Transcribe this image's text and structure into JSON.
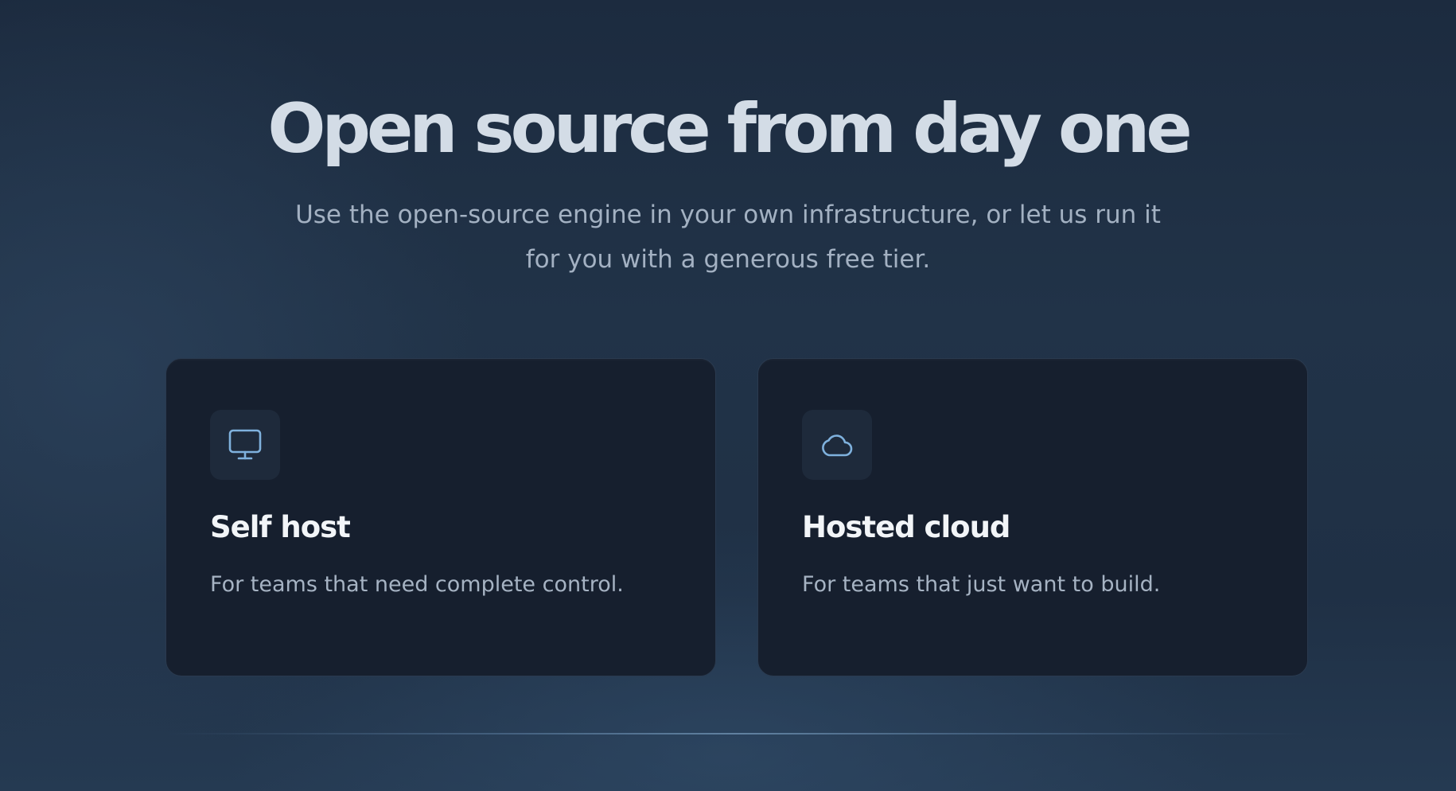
{
  "hero": {
    "title": "Open source from day one",
    "subtitle": "Use the open-source engine in your own infrastructure, or let us run it for you with a generous free tier."
  },
  "cards": [
    {
      "icon": "monitor-icon",
      "title": "Self host",
      "description": "For teams that need complete control."
    },
    {
      "icon": "cloud-icon",
      "title": "Hosted cloud",
      "description": "For teams that just want to build."
    }
  ],
  "colors": {
    "background": "#213348",
    "card_background": "#161f2e",
    "icon_accent": "#7fb1dd",
    "title_text": "#d3dce6"
  }
}
